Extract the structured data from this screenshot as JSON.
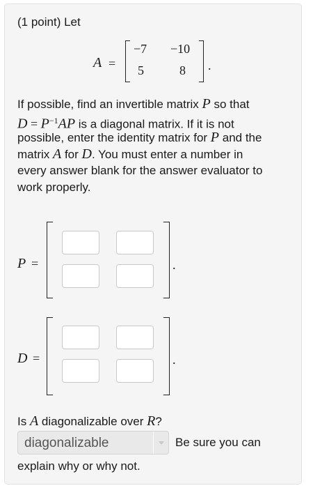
{
  "problem": {
    "intro": "(1 point) Let",
    "matrix_name": "A",
    "equals": "=",
    "matrix_A": [
      "−7",
      "−10",
      "5",
      "8"
    ],
    "period": "."
  },
  "question": {
    "lines": [
      [
        {
          "t": "If possible, find an invertible matrix "
        },
        {
          "t": "P",
          "m": true
        },
        {
          "t": " so that"
        }
      ],
      [
        {
          "t": "D",
          "m": true
        },
        {
          "t": " = ",
          "r": true
        },
        {
          "t": "P",
          "m": true
        },
        {
          "t": "−1",
          "sup": true
        },
        {
          "t": "AP",
          "m": true
        },
        {
          "t": " is a diagonal matrix. If it is not"
        }
      ],
      [
        {
          "t": "possible, enter the identity matrix for "
        },
        {
          "t": "P",
          "m": true
        },
        {
          "t": " and the"
        }
      ],
      [
        {
          "t": "matrix "
        },
        {
          "t": "A",
          "m": true
        },
        {
          "t": " for "
        },
        {
          "t": "D",
          "m": true
        },
        {
          "t": ". You must enter a number in"
        }
      ],
      [
        {
          "t": "every answer blank for the answer evaluator to"
        }
      ],
      [
        {
          "t": "work properly."
        }
      ]
    ]
  },
  "answer_P": {
    "label": "P",
    "equals": "=",
    "period": "."
  },
  "answer_D": {
    "label": "D",
    "equals": "=",
    "period": "."
  },
  "diag_question": {
    "before": "Is ",
    "A": "A",
    "middle": " diagonalizable over ",
    "R": "R",
    "after": "?"
  },
  "dropdown": {
    "selected": "diagonalizable"
  },
  "note": {
    "line1": "Be sure you can",
    "line2": "explain why or why not."
  }
}
